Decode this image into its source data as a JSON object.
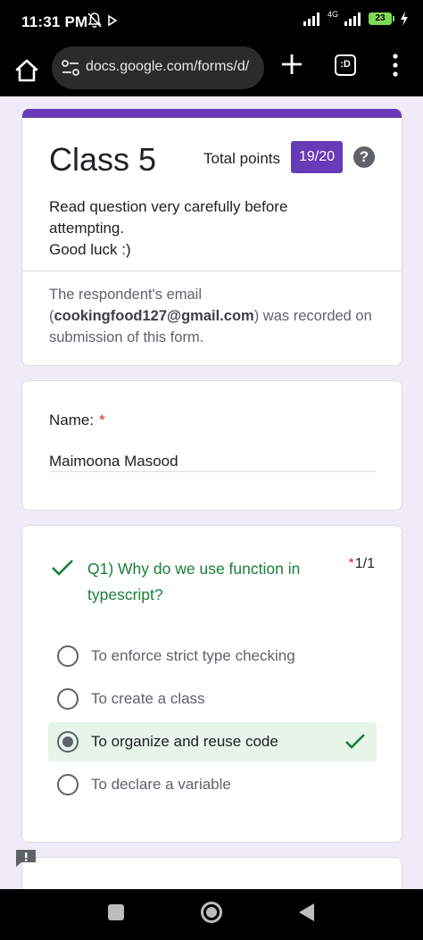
{
  "status_bar": {
    "time": "11:31 PM",
    "network": "4G",
    "battery": "23"
  },
  "browser": {
    "url": "docs.google.com/forms/d/",
    "tab_label": ":D"
  },
  "form": {
    "title": "Class 5",
    "points_label": "Total points",
    "points_value": "19/20",
    "help_glyph": "?",
    "description_lines": [
      "Read question very carefully before",
      "attempting.",
      "Good luck :)"
    ],
    "email_note_prefix": "The respondent's email (",
    "email": "cookingfood127@gmail.com",
    "email_note_suffix": ") was recorded on submission of this form."
  },
  "name_question": {
    "label": "Name:",
    "required_mark": "*",
    "answer": "Maimoona Masood"
  },
  "question1": {
    "text": "Q1) Why do we use function in typescript?",
    "required_mark": "*",
    "score": "1/1",
    "options": [
      {
        "label": "To enforce strict type checking"
      },
      {
        "label": "To create a class"
      },
      {
        "label": "To organize and reuse code"
      },
      {
        "label": "To declare a variable"
      }
    ],
    "selected_index": 2
  },
  "colors": {
    "accent": "#673ab7",
    "correct": "#188038",
    "required": "#d93025",
    "background": "#f0ebf8"
  }
}
